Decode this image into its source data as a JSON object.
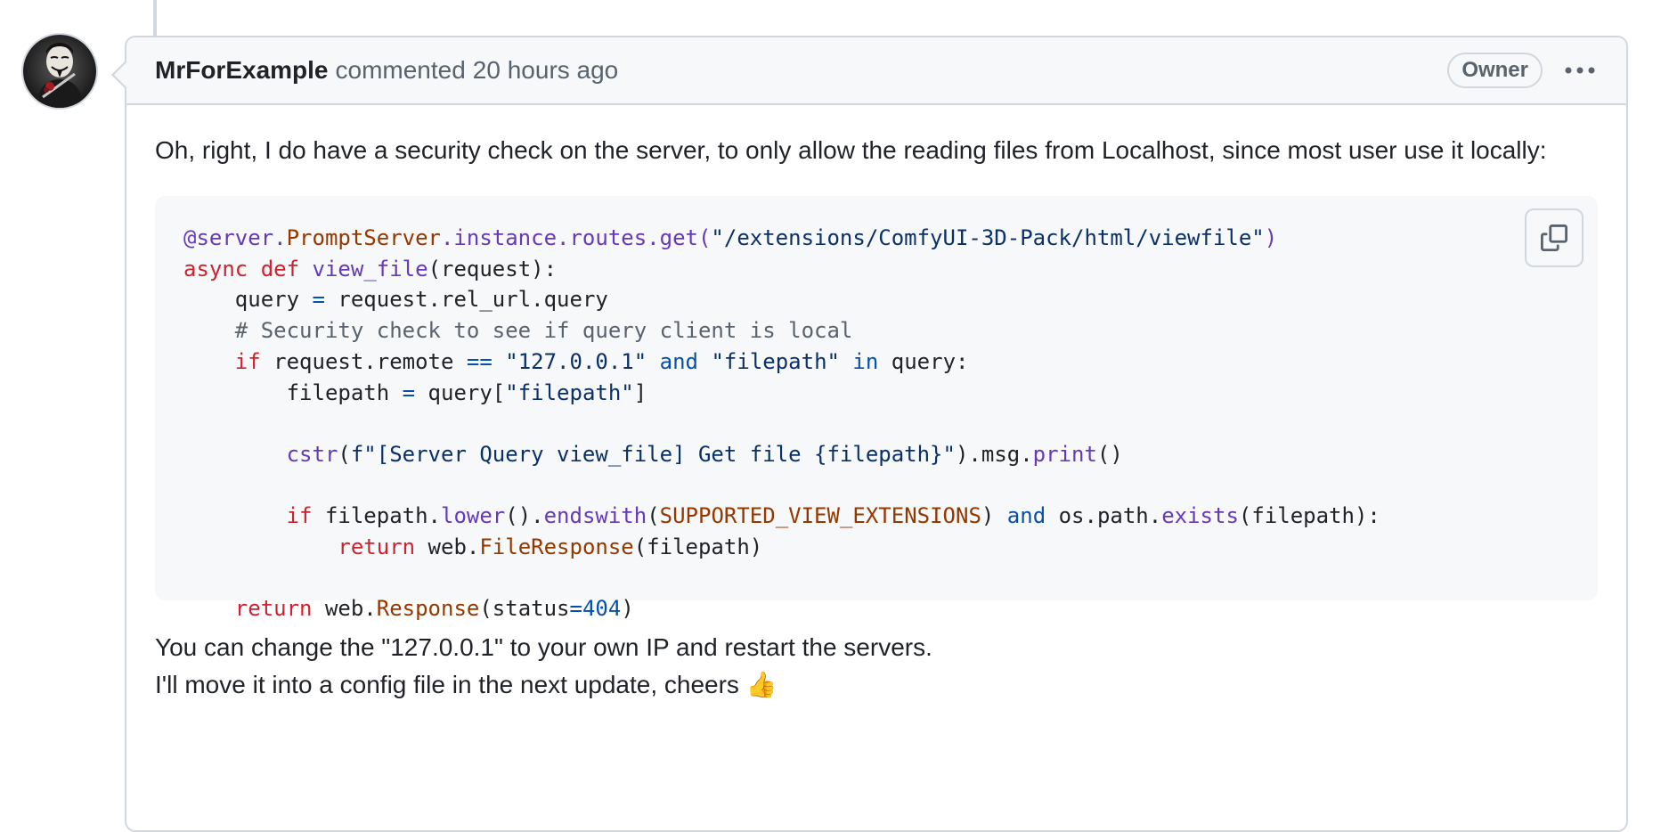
{
  "comment": {
    "author": "MrForExample",
    "action": "commented",
    "timestamp": "20 hours ago",
    "badge": "Owner",
    "menu_icon": "kebab-horizontal-icon",
    "body_intro": "Oh, right, I do have a security check on the server, to only allow the reading files from Localhost, since most user use it locally:",
    "body_outro_1": "You can change the \"127.0.0.1\" to your own IP and restart the servers.",
    "body_outro_2": "I'll move it into a config file in the next update, cheers 👍",
    "code_lines": [
      [
        [
          "at",
          "@server."
        ],
        [
          "cls",
          "PromptServer"
        ],
        [
          "at",
          ".instance.routes.get("
        ],
        [
          "str",
          "\"/extensions/ComfyUI-3D-Pack/html/viewfile\""
        ],
        [
          "at",
          ")"
        ]
      ],
      [
        [
          "kw",
          "async"
        ],
        [
          "txt",
          " "
        ],
        [
          "kw",
          "def"
        ],
        [
          "txt",
          " "
        ],
        [
          "fn",
          "view_file"
        ],
        [
          "txt",
          "(request):"
        ]
      ],
      [
        [
          "txt",
          "    query "
        ],
        [
          "op",
          "="
        ],
        [
          "txt",
          " request.rel_url.query"
        ]
      ],
      [
        [
          "cm",
          "    # Security check to see if query client is local"
        ]
      ],
      [
        [
          "kw",
          "    if"
        ],
        [
          "txt",
          " request.remote "
        ],
        [
          "op",
          "=="
        ],
        [
          "txt",
          " "
        ],
        [
          "str",
          "\"127.0.0.1\""
        ],
        [
          "txt",
          " "
        ],
        [
          "op",
          "and"
        ],
        [
          "txt",
          " "
        ],
        [
          "str",
          "\"filepath\""
        ],
        [
          "txt",
          " "
        ],
        [
          "op",
          "in"
        ],
        [
          "txt",
          " query:"
        ]
      ],
      [
        [
          "txt",
          "        filepath "
        ],
        [
          "op",
          "="
        ],
        [
          "txt",
          " query["
        ],
        [
          "str",
          "\"filepath\""
        ],
        [
          "txt",
          "]"
        ]
      ],
      [
        [
          "txt",
          ""
        ]
      ],
      [
        [
          "txt",
          "        "
        ],
        [
          "fn",
          "cstr"
        ],
        [
          "txt",
          "("
        ],
        [
          "str",
          "f\"[Server Query view_file] Get file {filepath}\""
        ],
        [
          "txt",
          ").msg."
        ],
        [
          "fn",
          "print"
        ],
        [
          "txt",
          "()"
        ]
      ],
      [
        [
          "txt",
          ""
        ]
      ],
      [
        [
          "kw",
          "        if"
        ],
        [
          "txt",
          " filepath."
        ],
        [
          "fn",
          "lower"
        ],
        [
          "txt",
          "()."
        ],
        [
          "fn",
          "endswith"
        ],
        [
          "txt",
          "("
        ],
        [
          "cls",
          "SUPPORTED_VIEW_EXTENSIONS"
        ],
        [
          "txt",
          ") "
        ],
        [
          "op",
          "and"
        ],
        [
          "txt",
          " os.path."
        ],
        [
          "fn",
          "exists"
        ],
        [
          "txt",
          "(filepath):"
        ]
      ],
      [
        [
          "kw",
          "            return"
        ],
        [
          "txt",
          " web."
        ],
        [
          "cls",
          "FileResponse"
        ],
        [
          "txt",
          "(filepath)"
        ]
      ],
      [
        [
          "txt",
          ""
        ]
      ],
      [
        [
          "kw",
          "    return"
        ],
        [
          "txt",
          " web."
        ],
        [
          "cls",
          "Response"
        ],
        [
          "txt",
          "(status"
        ],
        [
          "op",
          "="
        ],
        [
          "num",
          "404"
        ],
        [
          "txt",
          ")"
        ]
      ]
    ],
    "copy_icon": "copy-icon"
  }
}
